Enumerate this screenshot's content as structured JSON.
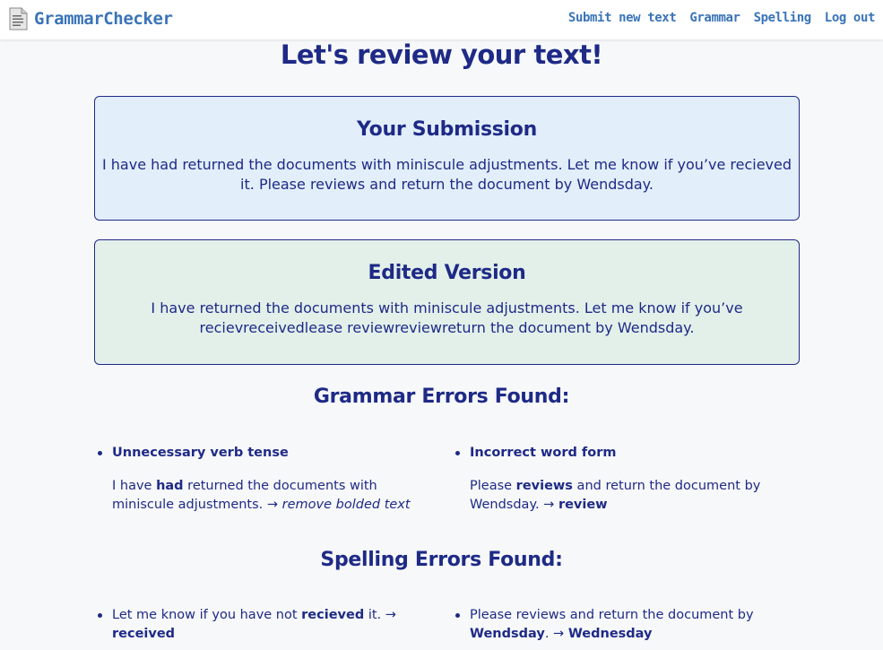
{
  "header": {
    "logo_text": "GrammarChecker",
    "nav": [
      "Submit new text",
      "Grammar",
      "Spelling",
      "Log out"
    ]
  },
  "page_title": "Let's review your text!",
  "submission": {
    "title": "Your Submission",
    "text": "I have had returned the documents with miniscule adjustments. Let me know if you’ve recieved it. Please reviews and return the document by Wendsday."
  },
  "edited": {
    "title": "Edited Version",
    "text": "I have returned the documents with miniscule adjustments. Let me know if you’ve recievreceivedlease reviewreviewreturn the document by Wendsday."
  },
  "grammar": {
    "title": "Grammar Errors Found:",
    "errors": [
      {
        "title": "Unnecessary verb tense",
        "before": "I have ",
        "highlight": "had",
        "after": " returned the documents with miniscule adjustments. → ",
        "fix": "remove bolded text"
      },
      {
        "title": "Incorrect word form",
        "before": "Please ",
        "highlight": "reviews",
        "after": " and return the document by Wendsday. → ",
        "fix": "review"
      }
    ]
  },
  "spelling": {
    "title": "Spelling Errors Found:",
    "errors": [
      {
        "before": "Let me know if you have not ",
        "highlight": "recieved",
        "after": " it. → ",
        "fix": "received"
      },
      {
        "before": "Please reviews and return the document by ",
        "highlight": "Wendsday",
        "after": ". → ",
        "fix": "Wednesday"
      }
    ]
  },
  "colors": {
    "heading": "#1e2a86",
    "nav_link": "#3a74b8",
    "submission_bg": "#e2eefa",
    "edited_bg": "#e3f0ea"
  }
}
